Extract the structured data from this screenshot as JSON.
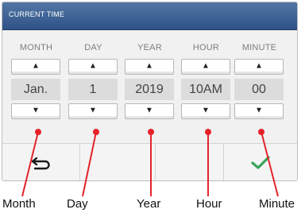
{
  "title": "CURRENT TIME",
  "columns": [
    {
      "label": "MONTH",
      "value": "Jan."
    },
    {
      "label": "DAY",
      "value": "1"
    },
    {
      "label": "YEAR",
      "value": "2019"
    },
    {
      "label": "HOUR",
      "value": "10AM"
    },
    {
      "label": "MINUTE",
      "value": "00"
    }
  ],
  "icons": {
    "up": "arrow-up-icon",
    "down": "arrow-down-icon",
    "back": "back-arrow-icon",
    "confirm": "checkmark-icon"
  },
  "colors": {
    "title_bar": "#3a6094",
    "confirm": "#3aa35b"
  },
  "callouts": [
    "Month",
    "Day",
    "Year",
    "Hour",
    "Minute"
  ]
}
